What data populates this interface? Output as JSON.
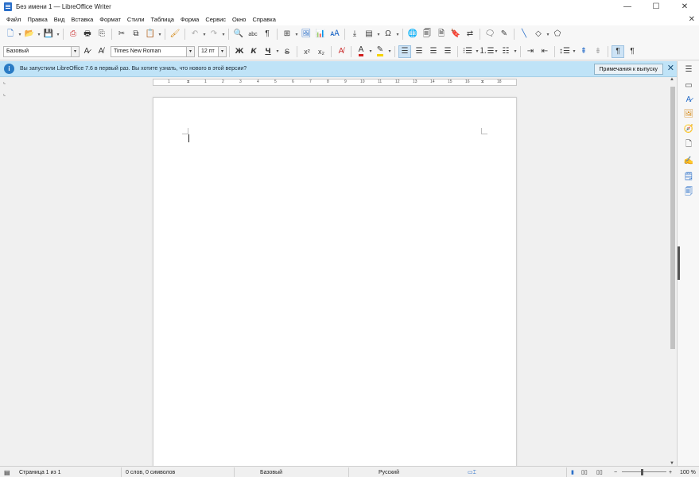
{
  "window": {
    "title": "Без имени 1 — LibreOffice Writer"
  },
  "menu": {
    "items": [
      "Файл",
      "Правка",
      "Вид",
      "Вставка",
      "Формат",
      "Стили",
      "Таблица",
      "Форма",
      "Сервис",
      "Окно",
      "Справка"
    ]
  },
  "format_bar": {
    "paragraph_style": "Базовый",
    "font_name": "Times New Roman",
    "font_size": "12 пт",
    "bold_label": "Ж",
    "italic_label": "К",
    "underline_label": "Ч",
    "strike_label": "S",
    "superscript_label": "x²",
    "subscript_label": "x₂"
  },
  "infobar": {
    "message": "Вы запустили LibreOffice 7.6 в первый раз. Вы хотите узнать, что нового в этой версии?",
    "button_label": "Примечания к выпуску"
  },
  "ruler": {
    "ticks": [
      "1",
      "1",
      "2",
      "3",
      "4",
      "5",
      "6",
      "7",
      "8",
      "9",
      "10",
      "11",
      "12",
      "13",
      "14",
      "15",
      "16",
      "17",
      "18"
    ]
  },
  "statusbar": {
    "page": "Страница 1 из 1",
    "words": "0 слов, 0 символов",
    "page_style": "Базовый",
    "language": "Русский",
    "zoom": "100 %"
  },
  "colors": {
    "accent": "#2a6fc9",
    "infobar_bg": "#bfe3f7",
    "font_color_bar": "#d11f1f",
    "highlight_bar": "#f5d300"
  }
}
